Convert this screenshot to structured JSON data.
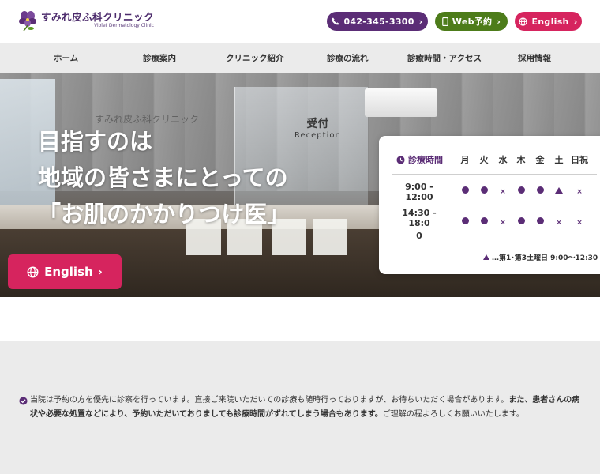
{
  "header": {
    "logo_jp": "すみれ皮ふ科クリニック",
    "logo_en": "Violet Dermatology Clinic",
    "tel_label": "042-345-3300",
    "web_label": "Web予約",
    "english_label": "English"
  },
  "nav": {
    "items": [
      "ホーム",
      "診療案内",
      "クリニック紹介",
      "診療の流れ",
      "診療時間・アクセス",
      "採用情報"
    ]
  },
  "hero": {
    "line1": "目指すのは",
    "line2": "地域の皆さまにとっての",
    "line3": "「お肌のかかりつけ医」",
    "english_label": "English",
    "reception_jp": "受付",
    "reception_en": "Reception",
    "wall_logo": "すみれ皮ふ科クリニック"
  },
  "schedule": {
    "title": "診療時間",
    "days": [
      "月",
      "火",
      "水",
      "木",
      "金",
      "土",
      "日祝"
    ],
    "rows": [
      {
        "time": "9:00 - 12:00",
        "marks": [
          "dot",
          "dot",
          "cross",
          "dot",
          "dot",
          "triangle",
          "cross"
        ]
      },
      {
        "time_line1": "14:30 - 18:0",
        "time_line2": "0",
        "marks": [
          "dot",
          "dot",
          "cross",
          "dot",
          "dot",
          "cross",
          "cross"
        ]
      }
    ],
    "note": "…第1･第3土曜日 9:00〜12:30"
  },
  "notice": {
    "text_normal": "当院は予約の方を優先に診察を行っています。直接ご来院いただいての診療も随時行っておりますが、お待ちいただく場合があります。",
    "text_bold": "また、患者さんの病状や必要な処置などにより、予約いただいておりましても診療時間がずれてしまう場合もあります。",
    "text_end": "ご理解の程よろしくお願いいたします。"
  },
  "colors": {
    "purple": "#5b2d76",
    "green": "#4d7c1a",
    "pink": "#d6245e",
    "nav_bg": "#ebebeb"
  }
}
